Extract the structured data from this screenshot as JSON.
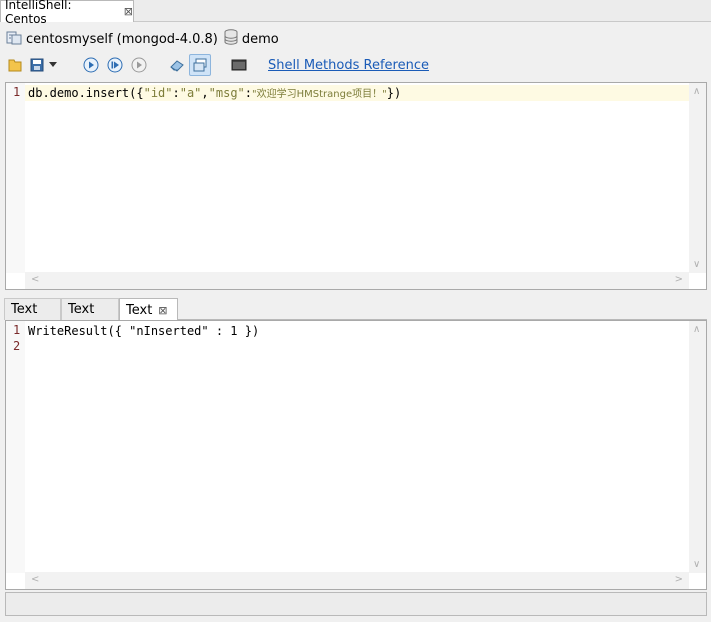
{
  "window_tab": {
    "title": "IntelliShell: Centos",
    "close_glyph": "⊠"
  },
  "connection": {
    "server": "centosmyself (mongod-4.0.8)",
    "database": "demo"
  },
  "toolbar": {
    "link": "Shell Methods Reference"
  },
  "editor": {
    "line_numbers": [
      "1"
    ],
    "code": {
      "p1": "db.demo.insert({",
      "s1": "\"id\"",
      "p2": ":",
      "s2": "\"a\"",
      "p3": ",",
      "s3": "\"msg\"",
      "p4": ":",
      "s4": "\"欢迎学习HMStrange项目！\"",
      "p5": "})"
    }
  },
  "result_tabs": [
    {
      "label": "Text"
    },
    {
      "label": "Text"
    },
    {
      "label": "Text",
      "close_glyph": "⊠"
    }
  ],
  "output": {
    "line_numbers": [
      "1",
      "2"
    ],
    "lines": [
      "WriteResult({ \"nInserted\" : 1 })",
      ""
    ]
  },
  "colors": {
    "link": "#1a5bb7",
    "string": "#7d7d3a",
    "line_number": "#7a2a2a",
    "current_line": "#fefae3"
  }
}
